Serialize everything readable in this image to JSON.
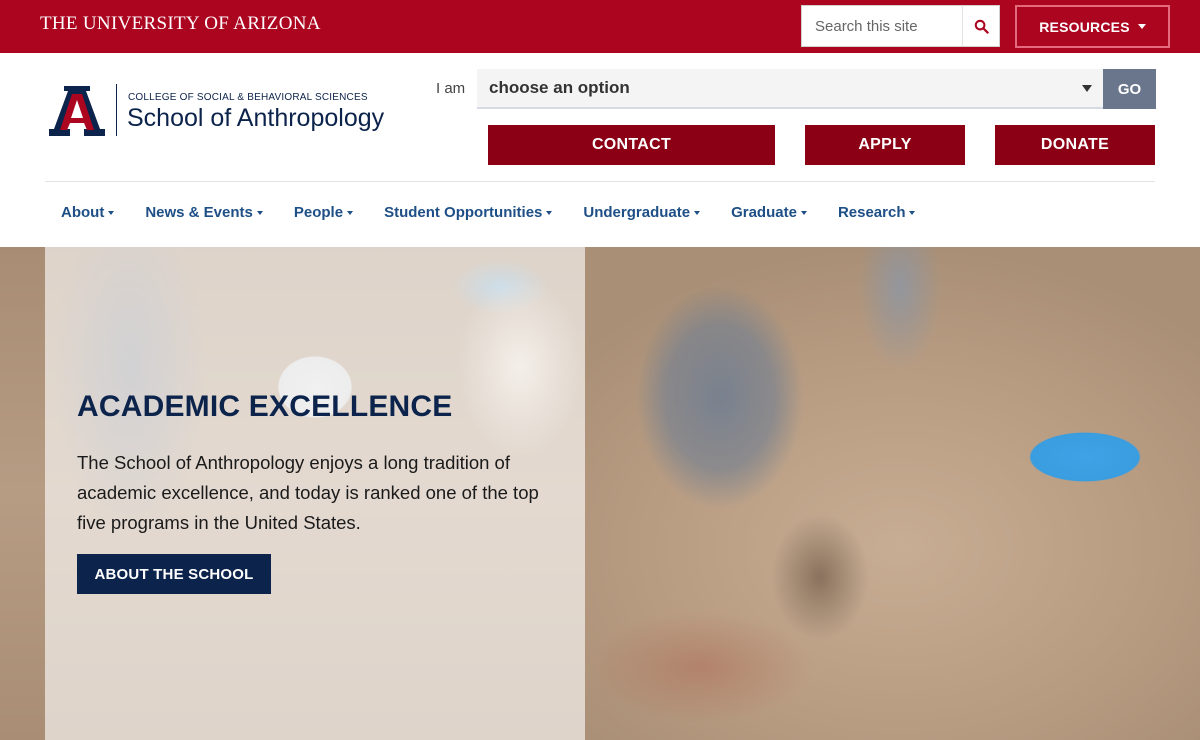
{
  "topbar": {
    "wordmark": {
      "the": "The",
      "university": "University",
      "of": "of",
      "arizona": "Arizona"
    },
    "search_placeholder": "Search this site",
    "resources_label": "RESOURCES",
    "colors": {
      "brand_red": "#ab0520",
      "navy": "#0c234b"
    }
  },
  "header": {
    "college_name": "COLLEGE OF SOCIAL & BEHAVIORAL SCIENCES",
    "school_name": "School of Anthropology",
    "iam_label": "I am",
    "select_value": "choose an option",
    "go_label": "GO",
    "contact_label": "CONTACT",
    "apply_label": "APPLY",
    "donate_label": "DONATE"
  },
  "nav": {
    "items": [
      {
        "label": "About"
      },
      {
        "label": "News & Events"
      },
      {
        "label": "People"
      },
      {
        "label": "Student Opportunities"
      },
      {
        "label": "Undergraduate"
      },
      {
        "label": "Graduate"
      },
      {
        "label": "Research"
      }
    ]
  },
  "hero": {
    "title": "ACADEMIC EXCELLENCE",
    "text": "The School of Anthropology enjoys a long tradition of academic excellence, and today is ranked one of the top five programs in the United States.",
    "button_label": "ABOUT THE SCHOOL"
  }
}
